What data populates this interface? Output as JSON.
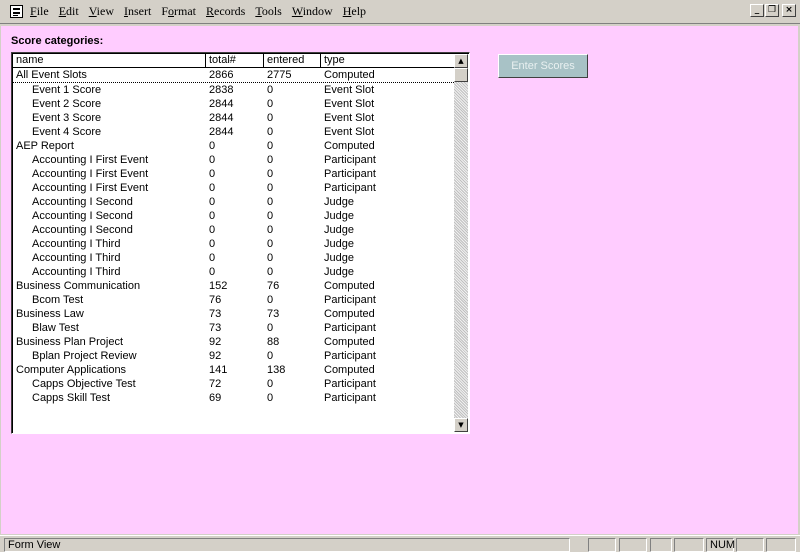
{
  "menubar": {
    "items": [
      {
        "underline": "F",
        "rest": "ile"
      },
      {
        "underline": "E",
        "rest": "dit"
      },
      {
        "underline": "V",
        "rest": "iew"
      },
      {
        "underline": "I",
        "rest": "nsert"
      },
      {
        "pre": "F",
        "underline": "o",
        "rest": "rmat"
      },
      {
        "underline": "R",
        "rest": "ecords"
      },
      {
        "underline": "T",
        "rest": "ools"
      },
      {
        "underline": "W",
        "rest": "indow"
      },
      {
        "underline": "H",
        "rest": "elp"
      }
    ]
  },
  "form": {
    "label": "Score categories:",
    "background": "#ffccff",
    "enter_button": "Enter Scores"
  },
  "list": {
    "columns": [
      "name",
      "total#",
      "entered",
      "type"
    ],
    "rows": [
      {
        "name": "All Event Slots",
        "total": "2866",
        "entered": "2775",
        "type": "Computed",
        "indent": false
      },
      {
        "name": "Event 1 Score",
        "total": "2838",
        "entered": "0",
        "type": "Event Slot",
        "indent": true
      },
      {
        "name": "Event 2 Score",
        "total": "2844",
        "entered": "0",
        "type": "Event Slot",
        "indent": true
      },
      {
        "name": "Event 3 Score",
        "total": "2844",
        "entered": "0",
        "type": "Event Slot",
        "indent": true
      },
      {
        "name": "Event 4 Score",
        "total": "2844",
        "entered": "0",
        "type": "Event Slot",
        "indent": true
      },
      {
        "name": "AEP Report",
        "total": "0",
        "entered": "0",
        "type": "Computed",
        "indent": false
      },
      {
        "name": "Accounting I First Event",
        "total": "0",
        "entered": "0",
        "type": "Participant",
        "indent": true
      },
      {
        "name": "Accounting I First Event",
        "total": "0",
        "entered": "0",
        "type": "Participant",
        "indent": true
      },
      {
        "name": "Accounting I First Event",
        "total": "0",
        "entered": "0",
        "type": "Participant",
        "indent": true
      },
      {
        "name": "Accounting I Second",
        "total": "0",
        "entered": "0",
        "type": "Judge",
        "indent": true
      },
      {
        "name": "Accounting I Second",
        "total": "0",
        "entered": "0",
        "type": "Judge",
        "indent": true
      },
      {
        "name": "Accounting I Second",
        "total": "0",
        "entered": "0",
        "type": "Judge",
        "indent": true
      },
      {
        "name": "Accounting I Third",
        "total": "0",
        "entered": "0",
        "type": "Judge",
        "indent": true
      },
      {
        "name": "Accounting I Third",
        "total": "0",
        "entered": "0",
        "type": "Judge",
        "indent": true
      },
      {
        "name": "Accounting I Third",
        "total": "0",
        "entered": "0",
        "type": "Judge",
        "indent": true
      },
      {
        "name": "Business Communication",
        "total": "152",
        "entered": "76",
        "type": "Computed",
        "indent": false
      },
      {
        "name": "Bcom Test",
        "total": "76",
        "entered": "0",
        "type": "Participant",
        "indent": true
      },
      {
        "name": "Business Law",
        "total": "73",
        "entered": "73",
        "type": "Computed",
        "indent": false
      },
      {
        "name": "Blaw Test",
        "total": "73",
        "entered": "0",
        "type": "Participant",
        "indent": true
      },
      {
        "name": "Business Plan Project",
        "total": "92",
        "entered": "88",
        "type": "Computed",
        "indent": false
      },
      {
        "name": "Bplan Project Review",
        "total": "92",
        "entered": "0",
        "type": "Participant",
        "indent": true
      },
      {
        "name": "Computer Applications",
        "total": "141",
        "entered": "138",
        "type": "Computed",
        "indent": false
      },
      {
        "name": "Capps Objective Test",
        "total": "72",
        "entered": "0",
        "type": "Participant",
        "indent": true
      },
      {
        "name": "Capps Skill Test",
        "total": "69",
        "entered": "0",
        "type": "Participant",
        "indent": true
      }
    ]
  },
  "statusbar": {
    "view": "Form View",
    "num": "NUM"
  }
}
